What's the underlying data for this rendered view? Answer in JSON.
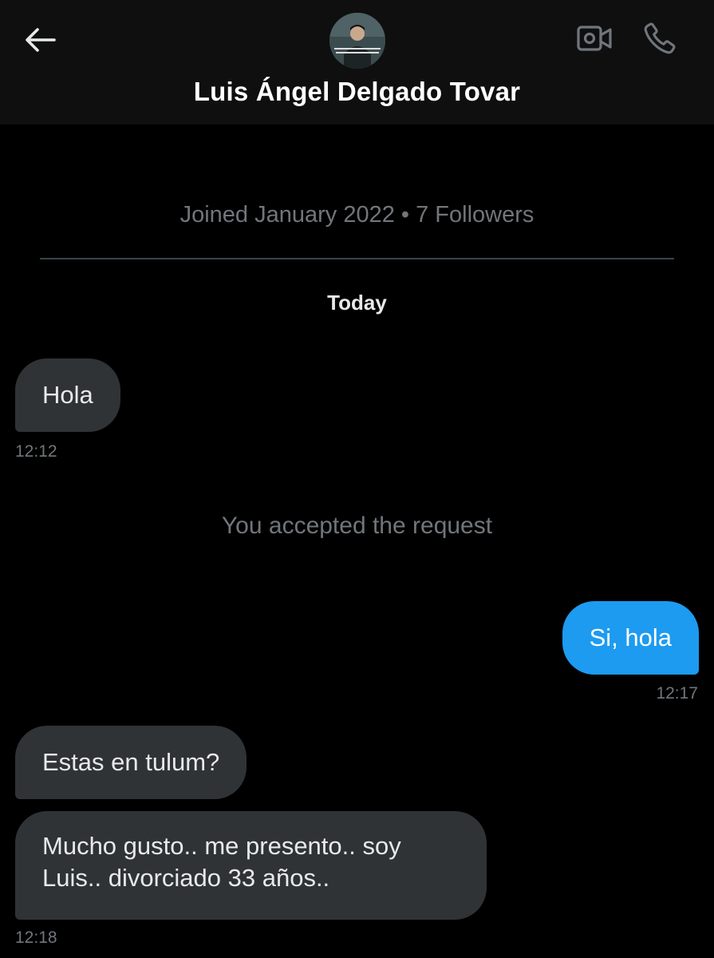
{
  "header": {
    "title": "Luis Ángel Delgado Tovar",
    "back_icon": "arrow-left-icon",
    "video_icon": "video-camera-icon",
    "call_icon": "phone-icon"
  },
  "profile": {
    "info": "Joined January 2022 • 7 Followers"
  },
  "conversation": {
    "date_label": "Today",
    "system_message": "You accepted the request",
    "messages": [
      {
        "direction": "incoming",
        "text": "Hola",
        "time": "12:12"
      },
      {
        "direction": "outgoing",
        "text": "Si, hola",
        "time": "12:17"
      },
      {
        "direction": "incoming",
        "text": "Estas en tulum?",
        "time": ""
      },
      {
        "direction": "incoming",
        "text": "Mucho gusto.. me presento.. soy Luis.. divorciado 33 años..",
        "time": "12:18"
      }
    ]
  },
  "colors": {
    "background": "#000000",
    "header_background": "#0f0f10",
    "incoming_bubble": "#2f3336",
    "outgoing_bubble": "#1d9bf0",
    "muted_text": "#71767b"
  }
}
